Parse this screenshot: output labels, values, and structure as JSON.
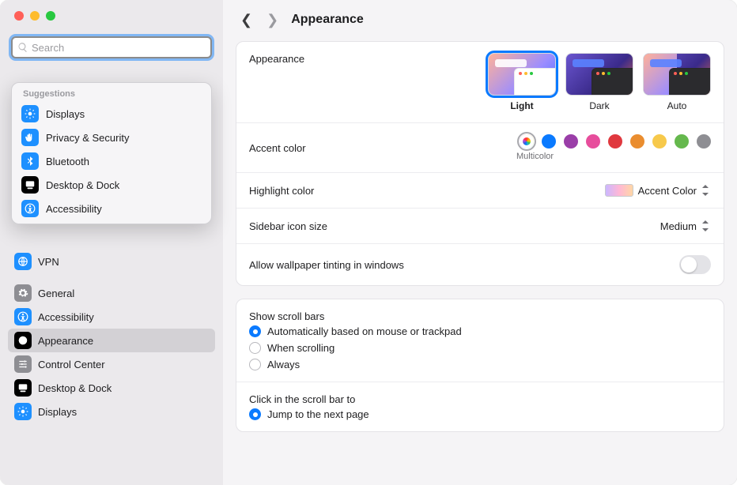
{
  "window": {
    "title": "Appearance"
  },
  "search": {
    "placeholder": "Search"
  },
  "suggestions": {
    "header": "Suggestions",
    "items": [
      {
        "label": "Displays",
        "color": "#1e90ff",
        "icon": "sun"
      },
      {
        "label": "Privacy & Security",
        "color": "#1e90ff",
        "icon": "hand"
      },
      {
        "label": "Bluetooth",
        "color": "#1e90ff",
        "icon": "bluetooth"
      },
      {
        "label": "Desktop & Dock",
        "color": "#000000",
        "icon": "dock"
      },
      {
        "label": "Accessibility",
        "color": "#1e90ff",
        "icon": "accessibility"
      }
    ]
  },
  "sidebar": {
    "items": [
      {
        "label": "VPN",
        "color": "#1e90ff",
        "icon": "globe"
      },
      {
        "label": "General",
        "color": "#8e8e93",
        "icon": "gear"
      },
      {
        "label": "Accessibility",
        "color": "#1e90ff",
        "icon": "accessibility"
      },
      {
        "label": "Appearance",
        "color": "#000000",
        "icon": "appearance",
        "active": true
      },
      {
        "label": "Control Center",
        "color": "#8e8e93",
        "icon": "sliders"
      },
      {
        "label": "Desktop & Dock",
        "color": "#000000",
        "icon": "dock"
      },
      {
        "label": "Displays",
        "color": "#1e90ff",
        "icon": "sun"
      }
    ]
  },
  "appearance": {
    "row_label": "Appearance",
    "options": [
      {
        "label": "Light",
        "mode": "light",
        "selected": true
      },
      {
        "label": "Dark",
        "mode": "dark",
        "selected": false
      },
      {
        "label": "Auto",
        "mode": "auto",
        "selected": false
      }
    ]
  },
  "accent": {
    "row_label": "Accent color",
    "selected_label": "Multicolor",
    "colors": [
      {
        "name": "Multicolor",
        "value": "multicolor",
        "selected": true
      },
      {
        "name": "Blue",
        "value": "#0a7aff"
      },
      {
        "name": "Purple",
        "value": "#9a3ea8"
      },
      {
        "name": "Pink",
        "value": "#e74d9c"
      },
      {
        "name": "Red",
        "value": "#e0383e"
      },
      {
        "name": "Orange",
        "value": "#ea8d2f"
      },
      {
        "name": "Yellow",
        "value": "#f7c94b"
      },
      {
        "name": "Green",
        "value": "#65b84d"
      },
      {
        "name": "Graphite",
        "value": "#8e8e93"
      }
    ]
  },
  "highlight": {
    "row_label": "Highlight color",
    "value": "Accent Color"
  },
  "icon_size": {
    "row_label": "Sidebar icon size",
    "value": "Medium"
  },
  "tinting": {
    "row_label": "Allow wallpaper tinting in windows",
    "on": false
  },
  "scrollbars": {
    "header": "Show scroll bars",
    "options": [
      {
        "label": "Automatically based on mouse or trackpad",
        "checked": true
      },
      {
        "label": "When scrolling",
        "checked": false
      },
      {
        "label": "Always",
        "checked": false
      }
    ]
  },
  "clickbar": {
    "header": "Click in the scroll bar to",
    "options": [
      {
        "label": "Jump to the next page",
        "checked": true
      }
    ]
  }
}
